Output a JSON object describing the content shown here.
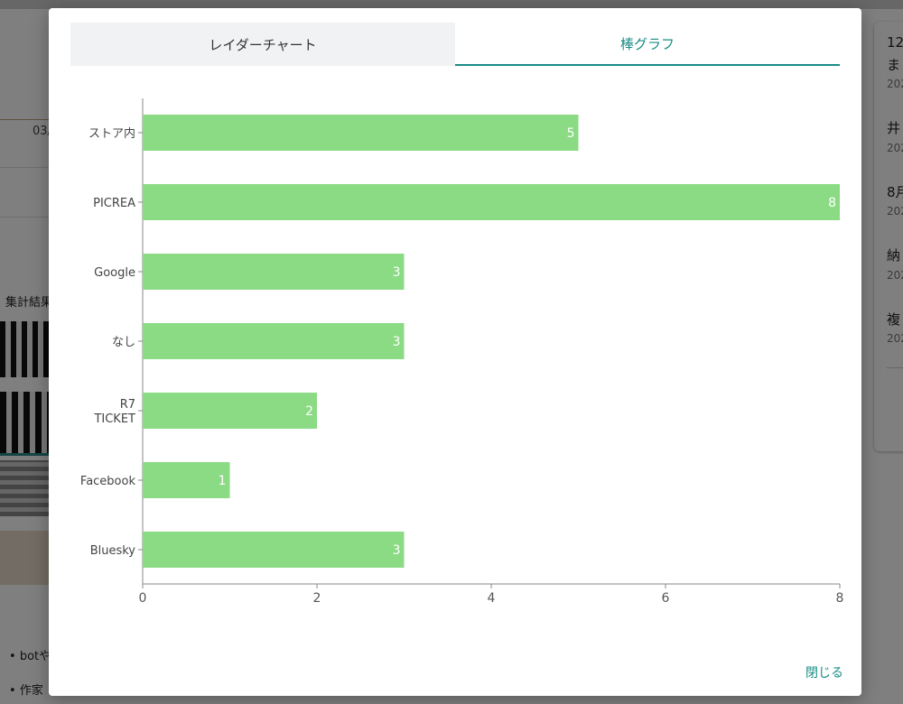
{
  "background": {
    "date_fragment": "03/",
    "results_label": "集計結果",
    "bullets": [
      "botや",
      "作家"
    ],
    "right_items": [
      {
        "title": "12",
        "title2": "ま",
        "sub": "202"
      },
      {
        "title": "井",
        "sub": "202"
      },
      {
        "title": "8月",
        "sub": "202"
      },
      {
        "title": "納",
        "sub": "202"
      },
      {
        "title": "複",
        "sub": "202"
      }
    ]
  },
  "modal": {
    "tabs": [
      {
        "label": "レイダーチャート",
        "active": false
      },
      {
        "label": "棒グラフ",
        "active": true
      }
    ],
    "close_label": "閉じる"
  },
  "chart_data": {
    "type": "bar",
    "orientation": "horizontal",
    "categories": [
      "ストア内",
      "PICREA",
      "Google",
      "なし",
      "R7\nTICKET",
      "Facebook",
      "Bluesky"
    ],
    "values": [
      5,
      8,
      3,
      3,
      2,
      1,
      3
    ],
    "xlim": [
      0,
      8
    ],
    "xticks": [
      0,
      2,
      4,
      6,
      8
    ],
    "bar_color": "#8bda84",
    "data_labels": true,
    "grid": false
  }
}
